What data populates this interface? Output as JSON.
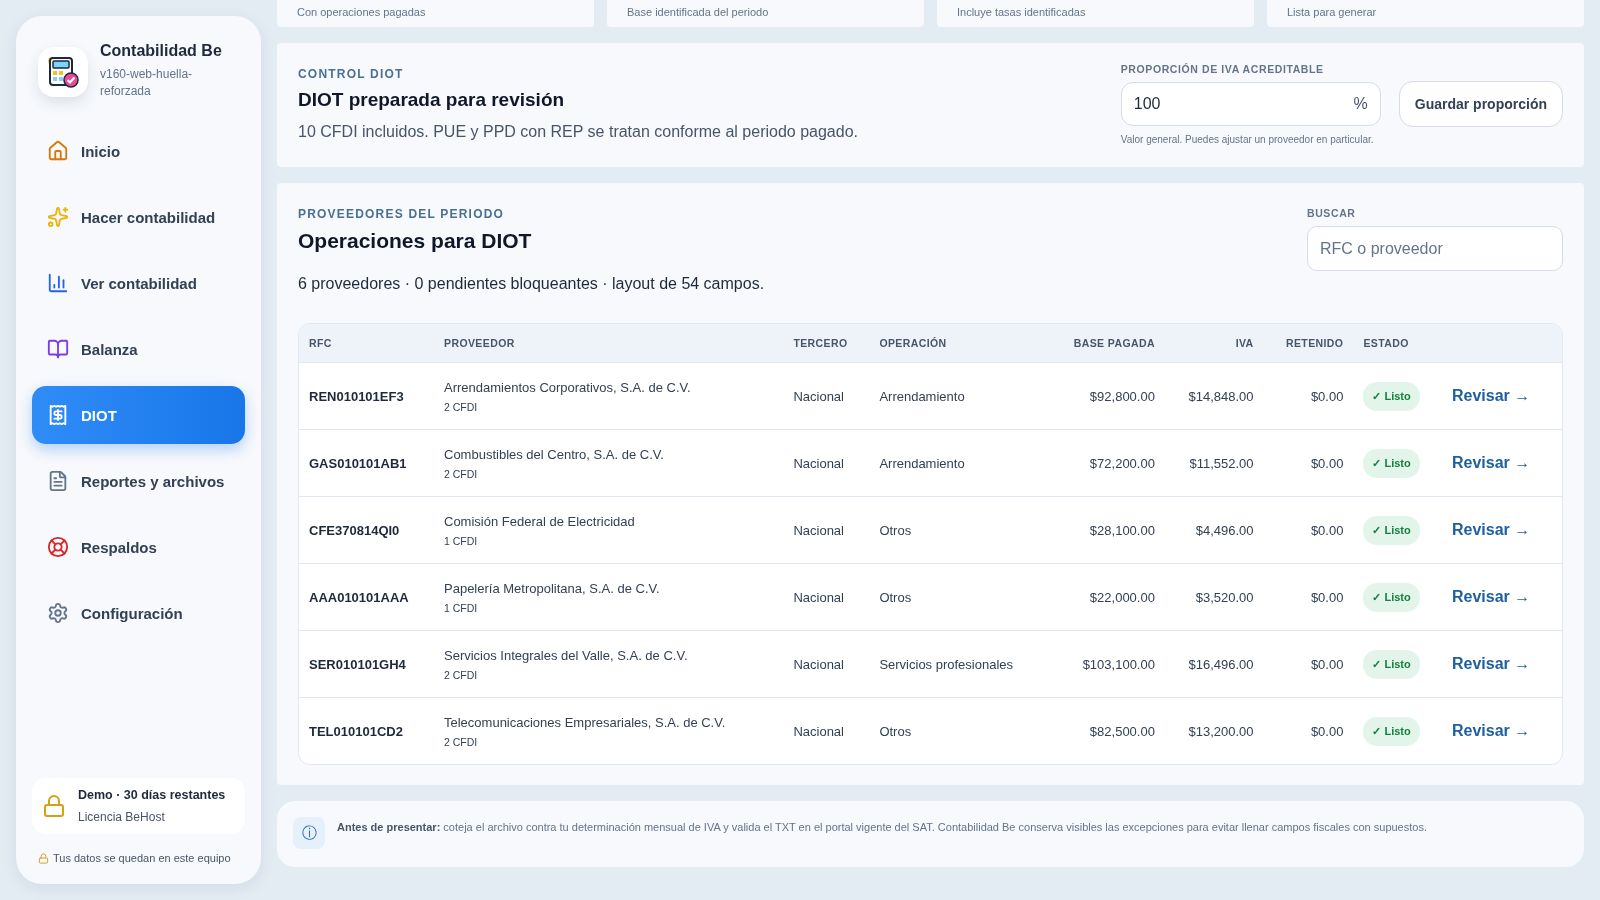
{
  "sidebar": {
    "app_name": "Contabilidad Be",
    "version": "v160-web-huella-reforzada",
    "items": [
      {
        "label": "Inicio",
        "selected": false
      },
      {
        "label": "Hacer contabilidad",
        "selected": false
      },
      {
        "label": "Ver contabilidad",
        "selected": false
      },
      {
        "label": "Balanza",
        "selected": false
      },
      {
        "label": "DIOT",
        "selected": true
      },
      {
        "label": "Reportes y archivos",
        "selected": false
      },
      {
        "label": "Respaldos",
        "selected": false
      },
      {
        "label": "Configuración",
        "selected": false
      }
    ],
    "license": {
      "title": "Demo · 30 días restantes",
      "subtitle": "Licencia BeHost"
    },
    "privacy_note": "Tus datos se quedan en este equipo"
  },
  "summary_cards": [
    "Con operaciones pagadas",
    "Base identificada del periodo",
    "Incluye tasas identificadas",
    "Lista para generar"
  ],
  "control": {
    "eyebrow": "CONTROL DIOT",
    "title": "DIOT preparada para revisión",
    "description": "10 CFDI incluidos. PUE y PPD con REP se tratan conforme al periodo pagado.",
    "proportion": {
      "label": "PROPORCIÓN DE IVA ACREDITABLE",
      "value": "100",
      "suffix": "%",
      "hint": "Valor general. Puedes ajustar un proveedor en particular."
    },
    "save_button": "Guardar proporción"
  },
  "providers": {
    "eyebrow": "PROVEEDORES DEL PERIODO",
    "title": "Operaciones para DIOT",
    "summary": "6 proveedores · 0 pendientes bloqueantes · layout de 54 campos.",
    "search": {
      "label": "BUSCAR",
      "placeholder": "RFC o proveedor"
    },
    "columns": [
      "RFC",
      "PROVEEDOR",
      "TERCERO",
      "OPERACIÓN",
      "BASE PAGADA",
      "IVA",
      "RETENIDO",
      "ESTADO"
    ],
    "rows": [
      {
        "rfc": "REN010101EF3",
        "name": "Arrendamientos Corporativos, S.A. de C.V.",
        "cfdi": "2 CFDI",
        "tercero": "Nacional",
        "operacion": "Arrendamiento",
        "base": "$92,800.00",
        "iva": "$14,848.00",
        "retenido": "$0.00",
        "estado": "✓ Listo",
        "action": "Revisar →"
      },
      {
        "rfc": "GAS010101AB1",
        "name": "Combustibles del Centro, S.A. de C.V.",
        "cfdi": "2 CFDI",
        "tercero": "Nacional",
        "operacion": "Arrendamiento",
        "base": "$72,200.00",
        "iva": "$11,552.00",
        "retenido": "$0.00",
        "estado": "✓ Listo",
        "action": "Revisar →"
      },
      {
        "rfc": "CFE370814QI0",
        "name": "Comisión Federal de Electricidad",
        "cfdi": "1 CFDI",
        "tercero": "Nacional",
        "operacion": "Otros",
        "base": "$28,100.00",
        "iva": "$4,496.00",
        "retenido": "$0.00",
        "estado": "✓ Listo",
        "action": "Revisar →"
      },
      {
        "rfc": "AAA010101AAA",
        "name": "Papelería Metropolitana, S.A. de C.V.",
        "cfdi": "1 CFDI",
        "tercero": "Nacional",
        "operacion": "Otros",
        "base": "$22,000.00",
        "iva": "$3,520.00",
        "retenido": "$0.00",
        "estado": "✓ Listo",
        "action": "Revisar →"
      },
      {
        "rfc": "SER010101GH4",
        "name": "Servicios Integrales del Valle, S.A. de C.V.",
        "cfdi": "2 CFDI",
        "tercero": "Nacional",
        "operacion": "Servicios profesionales",
        "base": "$103,100.00",
        "iva": "$16,496.00",
        "retenido": "$0.00",
        "estado": "✓ Listo",
        "action": "Revisar →"
      },
      {
        "rfc": "TEL010101CD2",
        "name": "Telecomunicaciones Empresariales, S.A. de C.V.",
        "cfdi": "2 CFDI",
        "tercero": "Nacional",
        "operacion": "Otros",
        "base": "$82,500.00",
        "iva": "$13,200.00",
        "retenido": "$0.00",
        "estado": "✓ Listo",
        "action": "Revisar →"
      }
    ]
  },
  "notice": {
    "icon": "ⓘ",
    "text": "**Antes de presentar:** coteja el archivo contra tu determinación mensual de IVA y valida el TXT en el portal vigente del SAT. Contabilidad Be conserva visibles las excepciones para evitar llenar campos fiscales con supuestos."
  }
}
